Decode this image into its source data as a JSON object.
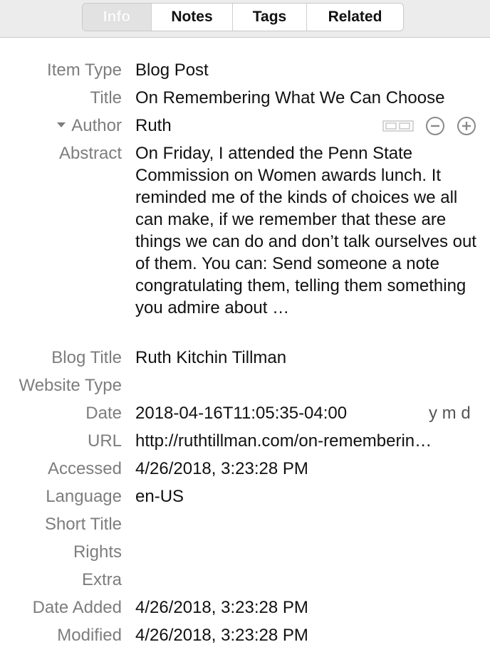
{
  "tabs": [
    {
      "label": "Info"
    },
    {
      "label": "Notes"
    },
    {
      "label": "Tags"
    },
    {
      "label": "Related"
    }
  ],
  "fields": {
    "item_type": {
      "label": "Item Type",
      "value": "Blog Post"
    },
    "title": {
      "label": "Title",
      "value": "On Remembering What We Can Choose"
    },
    "author": {
      "label": "Author",
      "value": "Ruth"
    },
    "abstract": {
      "label": "Abstract",
      "value": "On Friday, I attended the Penn State Commission on Women awards lunch. It reminded me of the kinds of choices we all can make, if we remember that these are things we can do and don’t talk ourselves out of them. You can: Send someone a note congratulating them, telling them something you admire about …"
    },
    "blog_title": {
      "label": "Blog Title",
      "value": "Ruth Kitchin Tillman"
    },
    "website_type": {
      "label": "Website Type",
      "value": ""
    },
    "date": {
      "label": "Date",
      "value": "2018-04-16T11:05:35-04:00",
      "format": "y m d"
    },
    "url": {
      "label": "URL",
      "value": "http://ruthtillman.com/on-rememberin…"
    },
    "accessed": {
      "label": "Accessed",
      "value": "4/26/2018, 3:23:28 PM"
    },
    "language": {
      "label": "Language",
      "value": "en-US"
    },
    "short_title": {
      "label": "Short Title",
      "value": ""
    },
    "rights": {
      "label": "Rights",
      "value": ""
    },
    "extra": {
      "label": "Extra",
      "value": ""
    },
    "date_added": {
      "label": "Date Added",
      "value": "4/26/2018, 3:23:28 PM"
    },
    "modified": {
      "label": "Modified",
      "value": "4/26/2018, 3:23:28 PM"
    }
  },
  "icons": {
    "creator_type_switch": "switch-name-mode-icon",
    "remove_creator": "minus-circle-icon",
    "add_creator": "plus-circle-icon",
    "disclosure": "disclosure-triangle-icon"
  },
  "colors": {
    "label": "#7d7d7d",
    "value": "#111111",
    "toolbar_bg": "#ececec",
    "selected_tab_bg": "#e2e2e2"
  }
}
